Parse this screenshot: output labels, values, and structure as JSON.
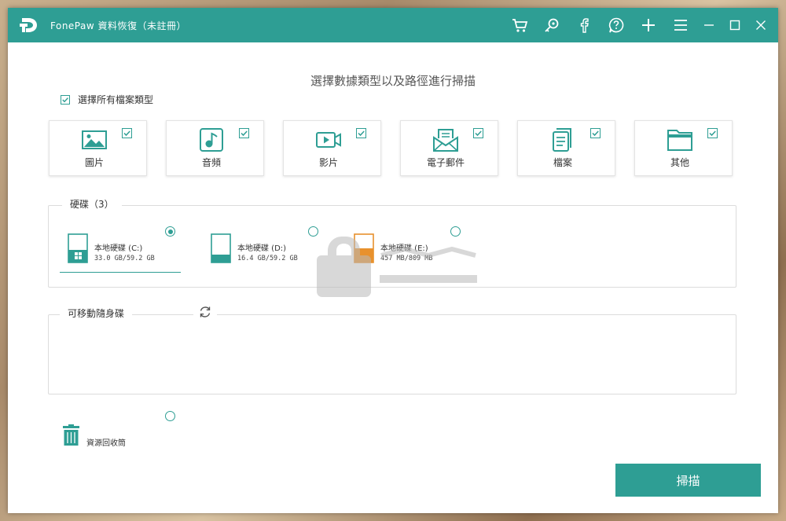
{
  "window": {
    "title": "FonePaw 資料恢復（未註冊）"
  },
  "toolbar_icons": [
    "cart-icon",
    "key-icon",
    "facebook-icon",
    "help-icon",
    "plus-icon",
    "menu-icon",
    "minimize-icon",
    "maximize-icon",
    "close-icon"
  ],
  "heading": "選擇數據類型以及路徑進行掃描",
  "select_all": {
    "label": "選擇所有檔案類型",
    "checked": true
  },
  "types": [
    {
      "label": "圖片",
      "icon": "image-icon",
      "checked": true
    },
    {
      "label": "音頻",
      "icon": "music-icon",
      "checked": true
    },
    {
      "label": "影片",
      "icon": "video-icon",
      "checked": true
    },
    {
      "label": "電子郵件",
      "icon": "email-icon",
      "checked": true
    },
    {
      "label": "檔案",
      "icon": "document-icon",
      "checked": true
    },
    {
      "label": "其他",
      "icon": "folder-icon",
      "checked": true
    }
  ],
  "disks": {
    "title": "硬碟（3）",
    "items": [
      {
        "name": "本地硬碟 (C:)",
        "size": "33.0 GB/59.2 GB",
        "selected": true,
        "fill": 0.56
      },
      {
        "name": "本地硬碟 (D:)",
        "size": "16.4 GB/59.2 GB",
        "selected": false,
        "fill": 0.28
      },
      {
        "name": "本地硬碟 (E:)",
        "size": "457 MB/809 MB",
        "selected": false,
        "fill": 0.56
      }
    ]
  },
  "removable": {
    "title": "可移動隨身碟"
  },
  "recycle_bin": {
    "label": "資源回收筒",
    "selected": false
  },
  "scan_button": "掃描",
  "colors": {
    "accent": "#2e9e94",
    "disk_orange": "#e8912d"
  }
}
